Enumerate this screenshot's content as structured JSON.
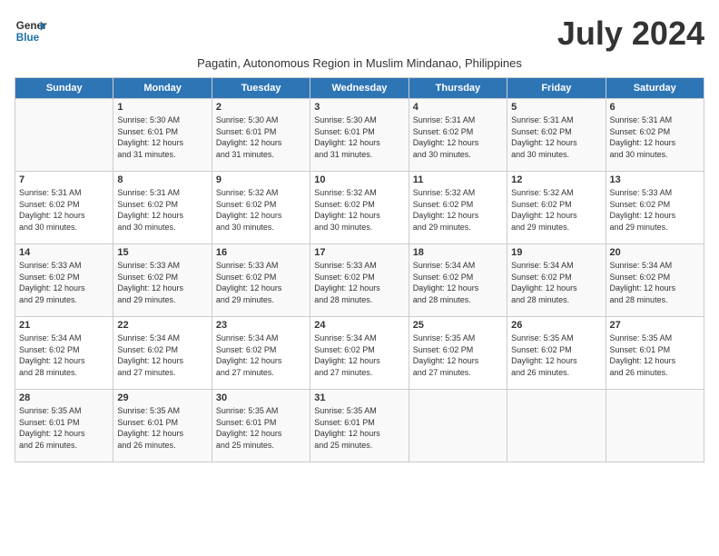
{
  "header": {
    "logo_line1": "General",
    "logo_line2": "Blue",
    "month_title": "July 2024",
    "subtitle": "Pagatin, Autonomous Region in Muslim Mindanao, Philippines"
  },
  "days_of_week": [
    "Sunday",
    "Monday",
    "Tuesday",
    "Wednesday",
    "Thursday",
    "Friday",
    "Saturday"
  ],
  "weeks": [
    [
      {
        "day": "",
        "info": ""
      },
      {
        "day": "1",
        "info": "Sunrise: 5:30 AM\nSunset: 6:01 PM\nDaylight: 12 hours\nand 31 minutes."
      },
      {
        "day": "2",
        "info": "Sunrise: 5:30 AM\nSunset: 6:01 PM\nDaylight: 12 hours\nand 31 minutes."
      },
      {
        "day": "3",
        "info": "Sunrise: 5:30 AM\nSunset: 6:01 PM\nDaylight: 12 hours\nand 31 minutes."
      },
      {
        "day": "4",
        "info": "Sunrise: 5:31 AM\nSunset: 6:02 PM\nDaylight: 12 hours\nand 30 minutes."
      },
      {
        "day": "5",
        "info": "Sunrise: 5:31 AM\nSunset: 6:02 PM\nDaylight: 12 hours\nand 30 minutes."
      },
      {
        "day": "6",
        "info": "Sunrise: 5:31 AM\nSunset: 6:02 PM\nDaylight: 12 hours\nand 30 minutes."
      }
    ],
    [
      {
        "day": "7",
        "info": "Sunrise: 5:31 AM\nSunset: 6:02 PM\nDaylight: 12 hours\nand 30 minutes."
      },
      {
        "day": "8",
        "info": "Sunrise: 5:31 AM\nSunset: 6:02 PM\nDaylight: 12 hours\nand 30 minutes."
      },
      {
        "day": "9",
        "info": "Sunrise: 5:32 AM\nSunset: 6:02 PM\nDaylight: 12 hours\nand 30 minutes."
      },
      {
        "day": "10",
        "info": "Sunrise: 5:32 AM\nSunset: 6:02 PM\nDaylight: 12 hours\nand 30 minutes."
      },
      {
        "day": "11",
        "info": "Sunrise: 5:32 AM\nSunset: 6:02 PM\nDaylight: 12 hours\nand 29 minutes."
      },
      {
        "day": "12",
        "info": "Sunrise: 5:32 AM\nSunset: 6:02 PM\nDaylight: 12 hours\nand 29 minutes."
      },
      {
        "day": "13",
        "info": "Sunrise: 5:33 AM\nSunset: 6:02 PM\nDaylight: 12 hours\nand 29 minutes."
      }
    ],
    [
      {
        "day": "14",
        "info": "Sunrise: 5:33 AM\nSunset: 6:02 PM\nDaylight: 12 hours\nand 29 minutes."
      },
      {
        "day": "15",
        "info": "Sunrise: 5:33 AM\nSunset: 6:02 PM\nDaylight: 12 hours\nand 29 minutes."
      },
      {
        "day": "16",
        "info": "Sunrise: 5:33 AM\nSunset: 6:02 PM\nDaylight: 12 hours\nand 29 minutes."
      },
      {
        "day": "17",
        "info": "Sunrise: 5:33 AM\nSunset: 6:02 PM\nDaylight: 12 hours\nand 28 minutes."
      },
      {
        "day": "18",
        "info": "Sunrise: 5:34 AM\nSunset: 6:02 PM\nDaylight: 12 hours\nand 28 minutes."
      },
      {
        "day": "19",
        "info": "Sunrise: 5:34 AM\nSunset: 6:02 PM\nDaylight: 12 hours\nand 28 minutes."
      },
      {
        "day": "20",
        "info": "Sunrise: 5:34 AM\nSunset: 6:02 PM\nDaylight: 12 hours\nand 28 minutes."
      }
    ],
    [
      {
        "day": "21",
        "info": "Sunrise: 5:34 AM\nSunset: 6:02 PM\nDaylight: 12 hours\nand 28 minutes."
      },
      {
        "day": "22",
        "info": "Sunrise: 5:34 AM\nSunset: 6:02 PM\nDaylight: 12 hours\nand 27 minutes."
      },
      {
        "day": "23",
        "info": "Sunrise: 5:34 AM\nSunset: 6:02 PM\nDaylight: 12 hours\nand 27 minutes."
      },
      {
        "day": "24",
        "info": "Sunrise: 5:34 AM\nSunset: 6:02 PM\nDaylight: 12 hours\nand 27 minutes."
      },
      {
        "day": "25",
        "info": "Sunrise: 5:35 AM\nSunset: 6:02 PM\nDaylight: 12 hours\nand 27 minutes."
      },
      {
        "day": "26",
        "info": "Sunrise: 5:35 AM\nSunset: 6:02 PM\nDaylight: 12 hours\nand 26 minutes."
      },
      {
        "day": "27",
        "info": "Sunrise: 5:35 AM\nSunset: 6:01 PM\nDaylight: 12 hours\nand 26 minutes."
      }
    ],
    [
      {
        "day": "28",
        "info": "Sunrise: 5:35 AM\nSunset: 6:01 PM\nDaylight: 12 hours\nand 26 minutes."
      },
      {
        "day": "29",
        "info": "Sunrise: 5:35 AM\nSunset: 6:01 PM\nDaylight: 12 hours\nand 26 minutes."
      },
      {
        "day": "30",
        "info": "Sunrise: 5:35 AM\nSunset: 6:01 PM\nDaylight: 12 hours\nand 25 minutes."
      },
      {
        "day": "31",
        "info": "Sunrise: 5:35 AM\nSunset: 6:01 PM\nDaylight: 12 hours\nand 25 minutes."
      },
      {
        "day": "",
        "info": ""
      },
      {
        "day": "",
        "info": ""
      },
      {
        "day": "",
        "info": ""
      }
    ]
  ]
}
